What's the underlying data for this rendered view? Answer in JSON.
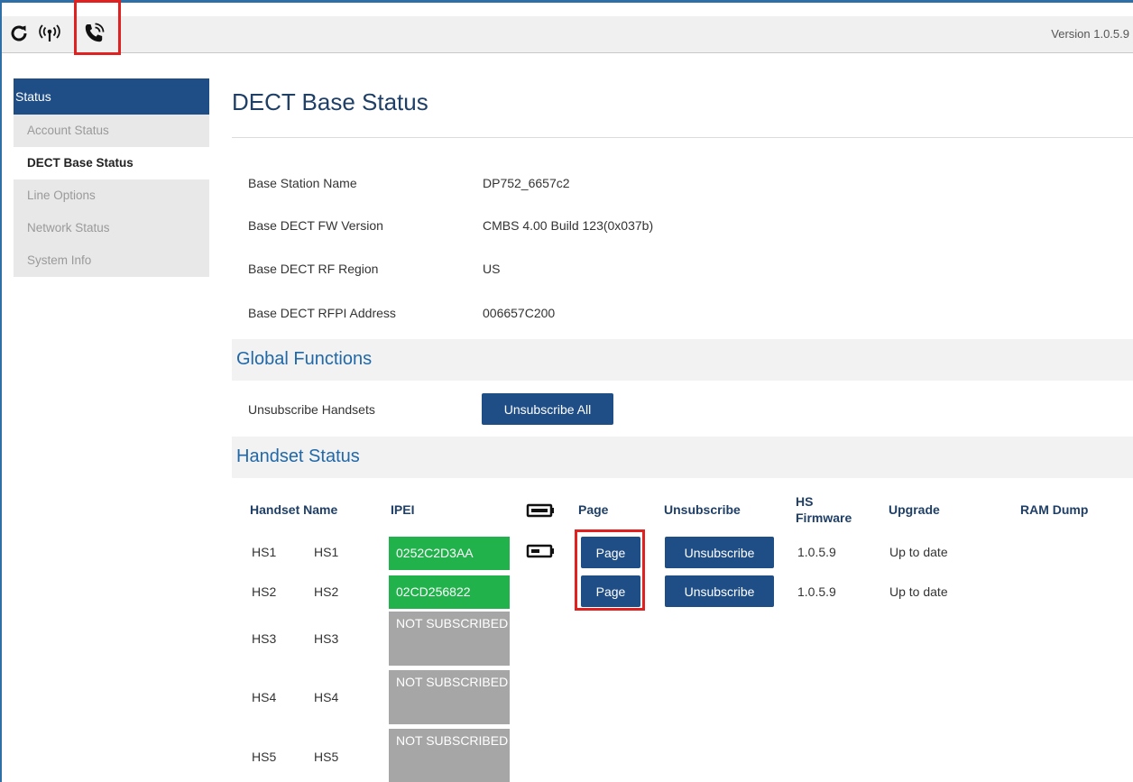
{
  "header": {
    "icons": [
      "refresh-icon",
      "signal-icon",
      "phone-ringing-icon"
    ],
    "version": "Version 1.0.5.9"
  },
  "sidebar": {
    "heading": "Status",
    "items": [
      {
        "label": "Account Status",
        "active": false
      },
      {
        "label": "DECT Base Status",
        "active": true
      },
      {
        "label": "Line Options",
        "active": false
      },
      {
        "label": "Network Status",
        "active": false
      },
      {
        "label": "System Info",
        "active": false
      }
    ]
  },
  "main": {
    "title": "DECT Base Status",
    "info": [
      {
        "label": "Base Station Name",
        "value": "DP752_6657c2"
      },
      {
        "label": "Base DECT FW Version",
        "value": "CMBS 4.00 Build 123(0x037b)"
      },
      {
        "label": "Base DECT RF Region",
        "value": "US"
      },
      {
        "label": "Base DECT RFPI Address",
        "value": "006657C200"
      }
    ],
    "global_functions": {
      "heading": "Global Functions",
      "label": "Unsubscribe Handsets",
      "button": "Unsubscribe All"
    },
    "handset_status": {
      "heading": "Handset Status",
      "columns": {
        "name": "Handset Name",
        "ipei": "IPEI",
        "battery": "battery-icon",
        "page": "Page",
        "unsubscribe": "Unsubscribe",
        "firmware": "HS Firmware",
        "upgrade": "Upgrade",
        "ramdump": "RAM Dump"
      },
      "rows": [
        {
          "id": "HS1",
          "name": "HS1",
          "ipei": "0252C2D3AA",
          "subscribed": true,
          "page": "Page",
          "unsubscribe": "Unsubscribe",
          "firmware": "1.0.5.9",
          "upgrade": "Up to date"
        },
        {
          "id": "HS2",
          "name": "HS2",
          "ipei": "02CD256822",
          "subscribed": true,
          "page": "Page",
          "unsubscribe": "Unsubscribe",
          "firmware": "1.0.5.9",
          "upgrade": "Up to date"
        },
        {
          "id": "HS3",
          "name": "HS3",
          "ipei": "NOT SUBSCRIBED",
          "subscribed": false
        },
        {
          "id": "HS4",
          "name": "HS4",
          "ipei": "NOT SUBSCRIBED",
          "subscribed": false
        },
        {
          "id": "HS5",
          "name": "HS5",
          "ipei": "NOT SUBSCRIBED",
          "subscribed": false
        }
      ]
    }
  },
  "colors": {
    "accent": "#1f4e86",
    "subscribed": "#22b24c",
    "not_subscribed": "#a6a6a6",
    "highlight": "#e0211f"
  }
}
